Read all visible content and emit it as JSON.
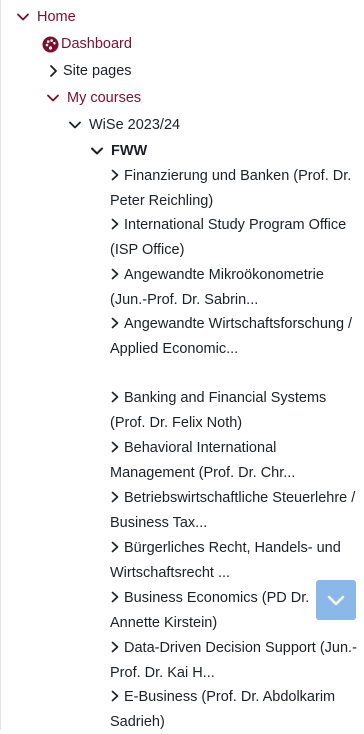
{
  "nav": {
    "home": "Home",
    "dashboard": "Dashboard",
    "site_pages": "Site pages",
    "my_courses": "My courses",
    "semester": "WiSe 2023/24",
    "faculty": "FWW"
  },
  "courses": [
    "Finanzierung und Banken (Prof. Dr. Peter Reichling)",
    "International Study Program Office (ISP Office)",
    "Angewandte Mikroökonometrie (Jun.-Prof. Dr. Sabrin...",
    "Angewandte Wirtschaftsforschung / Applied Economic...",
    "Banking and Financial Systems (Prof. Dr. Felix Noth)",
    "Behavioral International Management (Prof. Dr. Chr...",
    "Betriebswirtschaftliche Steuerlehre / Business Tax...",
    "Bürgerliches Recht, Handels- und Wirtschaftsrecht ...",
    "Business Economics (PD Dr. Annette Kirstein)",
    "Data-Driven Decision Support (Jun.-Prof. Dr. Kai H...",
    "E-Business (Prof. Dr. Abdolkarim Sadrieh)"
  ],
  "colors": {
    "accent": "#7a0f2e",
    "text": "#1d2125",
    "scroll_button": "#8ab8e8"
  },
  "icons": {
    "expanded": "chevron-down-icon",
    "collapsed": "chevron-right-icon",
    "dashboard": "dashboard-icon",
    "scroll": "scroll-down-icon"
  }
}
